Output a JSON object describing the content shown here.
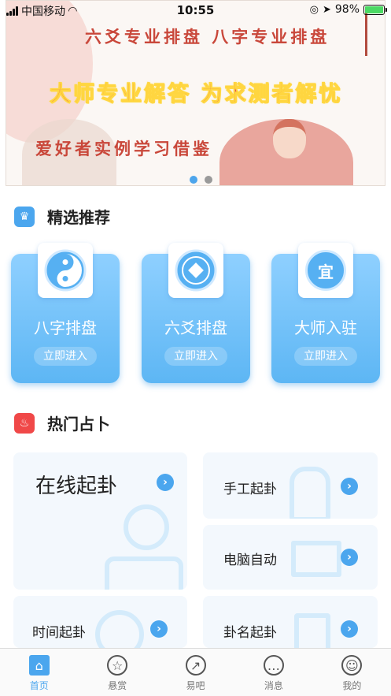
{
  "status_bar": {
    "carrier": "中国移动",
    "time": "10:55",
    "battery": "98%",
    "battery_level": 0.98
  },
  "banner": {
    "line1": "六爻专业排盘  八字专业排盘",
    "line2": "大师专业解答  为求测者解忧",
    "line3": "爱好者实例学习借鉴",
    "active_slide": 1,
    "slide_count": 2
  },
  "featured": {
    "title": "精选推荐",
    "cards": [
      {
        "title": "八字排盘",
        "icon": "yin-yang-icon",
        "button": "立即进入"
      },
      {
        "title": "六爻排盘",
        "icon": "coin-icon",
        "button": "立即进入"
      },
      {
        "title": "大师入驻",
        "icon": "yi-seal-icon",
        "icon_text": "宜",
        "button": "立即进入"
      }
    ]
  },
  "hot": {
    "title": "热门占卜",
    "items": [
      {
        "label": "在线起卦",
        "icon": "person-icon"
      },
      {
        "label": "手工起卦",
        "icon": "hand-pointer-icon"
      },
      {
        "label": "电脑自动",
        "icon": "computer-icon"
      },
      {
        "label": "时间起卦",
        "icon": "clock-icon"
      },
      {
        "label": "卦名起卦",
        "icon": "clipboard-icon"
      }
    ]
  },
  "tabbar": {
    "tabs": [
      {
        "label": "首页",
        "icon": "home-icon",
        "active": true
      },
      {
        "label": "悬赏",
        "icon": "star-badge-icon",
        "active": false
      },
      {
        "label": "易吧",
        "icon": "compass-icon",
        "active": false
      },
      {
        "label": "消息",
        "icon": "chat-icon",
        "active": false
      },
      {
        "label": "我的",
        "icon": "user-icon",
        "active": false
      }
    ]
  },
  "colors": {
    "accent": "#4ba6ee",
    "banner_red": "#c9473a",
    "hot_icon": "#f04848",
    "crown_icon": "#4ba6ee"
  }
}
